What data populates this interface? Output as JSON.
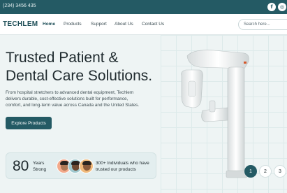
{
  "topbar": {
    "phone": "(234) 3456 435",
    "social": [
      {
        "icon": "facebook-icon",
        "glyph": "f"
      },
      {
        "icon": "instagram-icon",
        "glyph": "◎"
      }
    ]
  },
  "nav": {
    "logo": "TECHLEM",
    "links": [
      {
        "label": "Home",
        "active": true
      },
      {
        "label": "Products"
      },
      {
        "label": "Support"
      },
      {
        "label": "About Us"
      },
      {
        "label": "Contact Us"
      }
    ],
    "search_placeholder": "Search here..."
  },
  "hero": {
    "title_line1": "Trusted Patient &",
    "title_line2": "Dental Care Solutions.",
    "description": "From hospital stretchers to advanced dental equipment, Techlem delivers durable, cost-effective solutions built for performance, comfort, and long-term value across Canada and the United States.",
    "cta_label": "Explore Products"
  },
  "stats": {
    "years_number": "80",
    "years_label": "Years Strong",
    "individuals_text": "300+ Individuals who have trusted our products"
  },
  "pagination": {
    "pages": [
      "1",
      "2",
      "3"
    ],
    "current": "1"
  },
  "colors": {
    "primary": "#245a64",
    "background": "#eef4f4",
    "text": "#1f2a2e"
  }
}
